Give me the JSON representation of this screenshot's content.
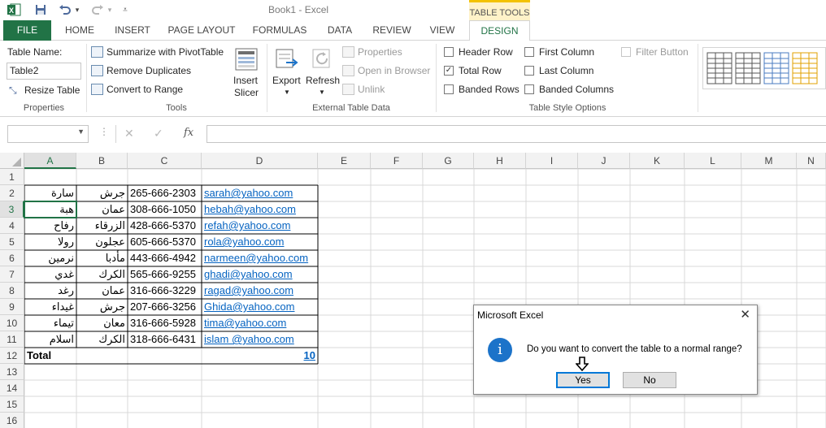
{
  "window": {
    "title": "Book1 - Excel",
    "context_tab_group": "TABLE TOOLS"
  },
  "tabs": [
    "FILE",
    "HOME",
    "INSERT",
    "PAGE LAYOUT",
    "FORMULAS",
    "DATA",
    "REVIEW",
    "VIEW",
    "DESIGN"
  ],
  "ribbon": {
    "properties": {
      "table_name_label": "Table Name:",
      "table_name_value": "Table2",
      "resize_label": "Resize Table",
      "group": "Properties"
    },
    "tools": {
      "summarize": "Summarize with PivotTable",
      "remove_duplicates": "Remove Duplicates",
      "convert_range": "Convert to Range",
      "insert_slicer_1": "Insert",
      "insert_slicer_2": "Slicer",
      "group": "Tools"
    },
    "external": {
      "export": "Export",
      "refresh": "Refresh",
      "properties": "Properties",
      "open_browser": "Open in Browser",
      "unlink": "Unlink",
      "group": "External Table Data"
    },
    "style_options": {
      "header_row": "Header Row",
      "total_row": "Total Row",
      "banded_rows": "Banded Rows",
      "first_column": "First Column",
      "last_column": "Last Column",
      "banded_columns": "Banded Columns",
      "filter_button": "Filter Button",
      "group": "Table Style Options",
      "checked": {
        "header_row": false,
        "total_row": true,
        "banded_rows": false,
        "first_column": false,
        "last_column": false,
        "banded_columns": false,
        "filter_button": false
      }
    }
  },
  "formula_bar": {
    "name_box": "",
    "fx": "fx",
    "value": ""
  },
  "sheet": {
    "columns": [
      "A",
      "B",
      "C",
      "D",
      "E",
      "F",
      "G",
      "H",
      "I",
      "J",
      "K",
      "L",
      "M",
      "N"
    ],
    "rows": [
      "1",
      "2",
      "3",
      "4",
      "5",
      "6",
      "7",
      "8",
      "9",
      "10",
      "11",
      "12",
      "13",
      "14",
      "15",
      "16"
    ],
    "selected_cell": "A3",
    "data": [
      [
        "سارة",
        "جرش",
        "265-666-2303",
        "sarah@yahoo.com"
      ],
      [
        "هبة",
        "عمان",
        "308-666-1050",
        "hebah@yahoo.com"
      ],
      [
        "رفاح",
        "الزرقاء",
        "428-666-5370",
        "refah@yahoo.com"
      ],
      [
        "رولا",
        "عجلون",
        "605-666-5370",
        "rola@yahoo.com"
      ],
      [
        "نرمين",
        "مأدبا",
        "443-666-4942",
        "narmeen@yahoo.com"
      ],
      [
        "غدي",
        "الكرك",
        "565-666-9255",
        "ghadi@yahoo.com"
      ],
      [
        "رغد",
        "عمان",
        "316-666-3229",
        "ragad@yahoo.com"
      ],
      [
        "غيداء",
        "جرش",
        "207-666-3256",
        "Ghida@yahoo.com"
      ],
      [
        "تيماء",
        "معان",
        "316-666-5928",
        "tima@yahoo.com"
      ],
      [
        "اسلام",
        "الكرك",
        "318-666-6431",
        "islam @yahoo.com"
      ]
    ],
    "total_label": "Total",
    "total_value": "10"
  },
  "dialog": {
    "title": "Microsoft Excel",
    "message": "Do you want to convert the table to a normal range?",
    "icon": "info-icon",
    "yes": "Yes",
    "no": "No"
  },
  "colors": {
    "excel_green": "#217346",
    "link": "#0563c1",
    "accent_yellow": "#f3c200",
    "info_blue": "#1c73c9"
  }
}
